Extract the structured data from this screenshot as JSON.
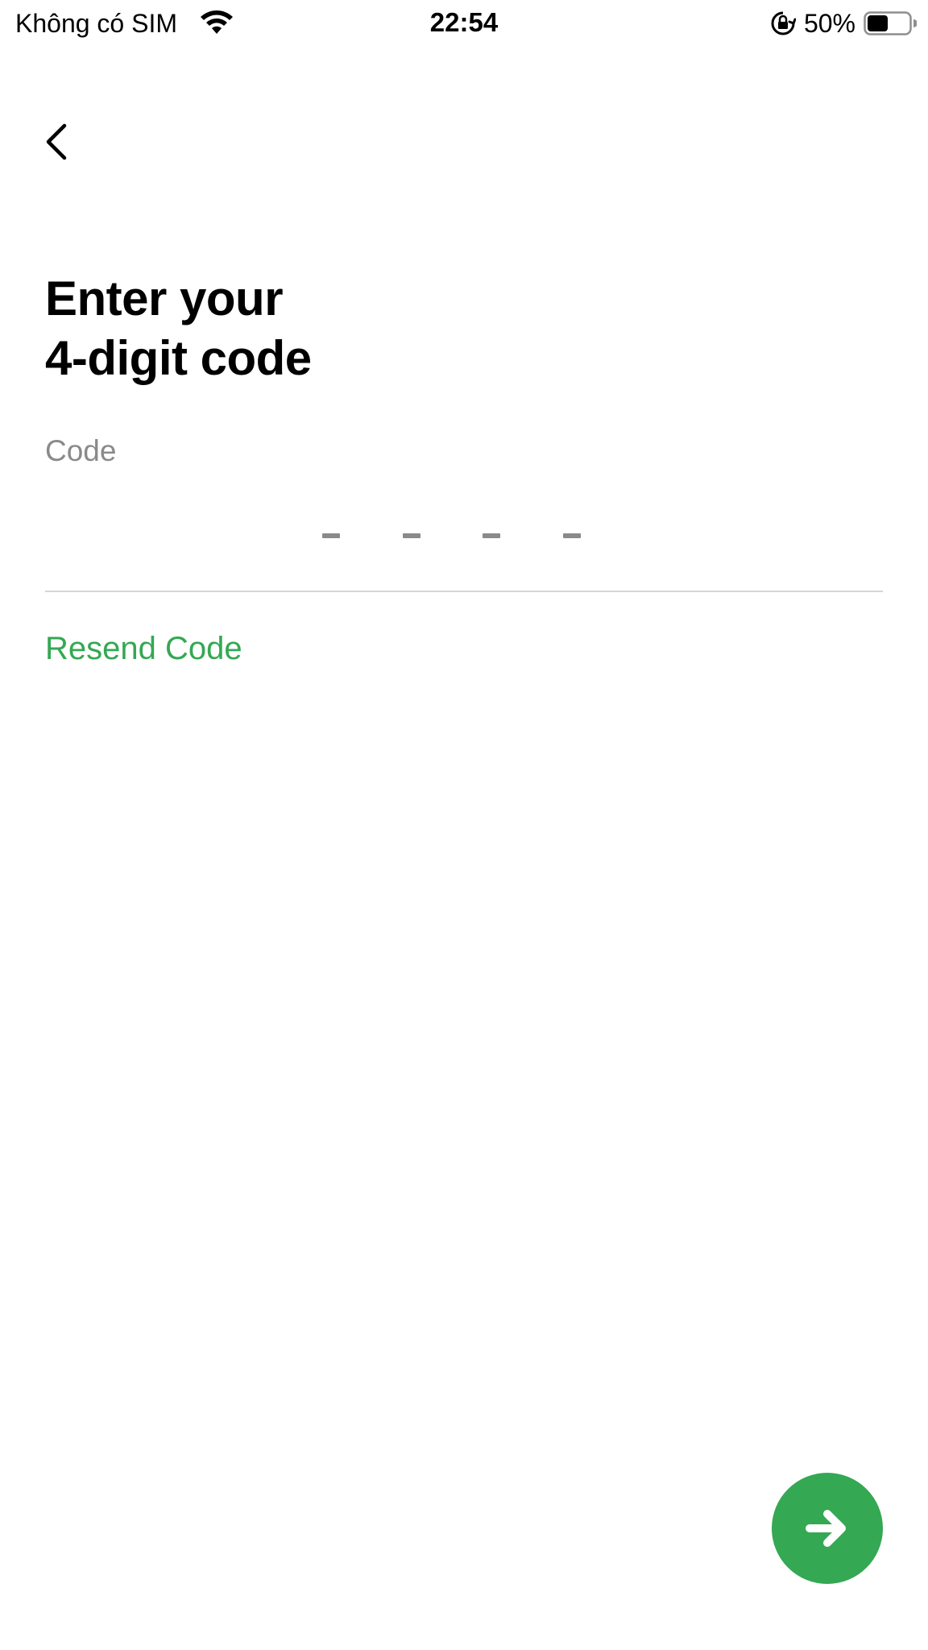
{
  "status_bar": {
    "carrier": "Không có SIM",
    "time": "22:54",
    "battery_percent": "50%",
    "battery_level": 0.5,
    "icons": [
      "wifi-icon",
      "orientation-lock-icon",
      "battery-icon"
    ]
  },
  "nav": {
    "back_icon": "chevron-left-icon"
  },
  "header": {
    "title_line1": "Enter your",
    "title_line2": "4-digit code"
  },
  "code_field": {
    "label": "Code",
    "value": "",
    "placeholder_slots": [
      "-",
      "-",
      "-",
      "-"
    ]
  },
  "actions": {
    "resend_label": "Resend Code",
    "next_icon": "arrow-right-icon"
  },
  "colors": {
    "accent": "#34a853",
    "label_gray": "#8a8a8a",
    "divider": "#d6d6d6"
  }
}
